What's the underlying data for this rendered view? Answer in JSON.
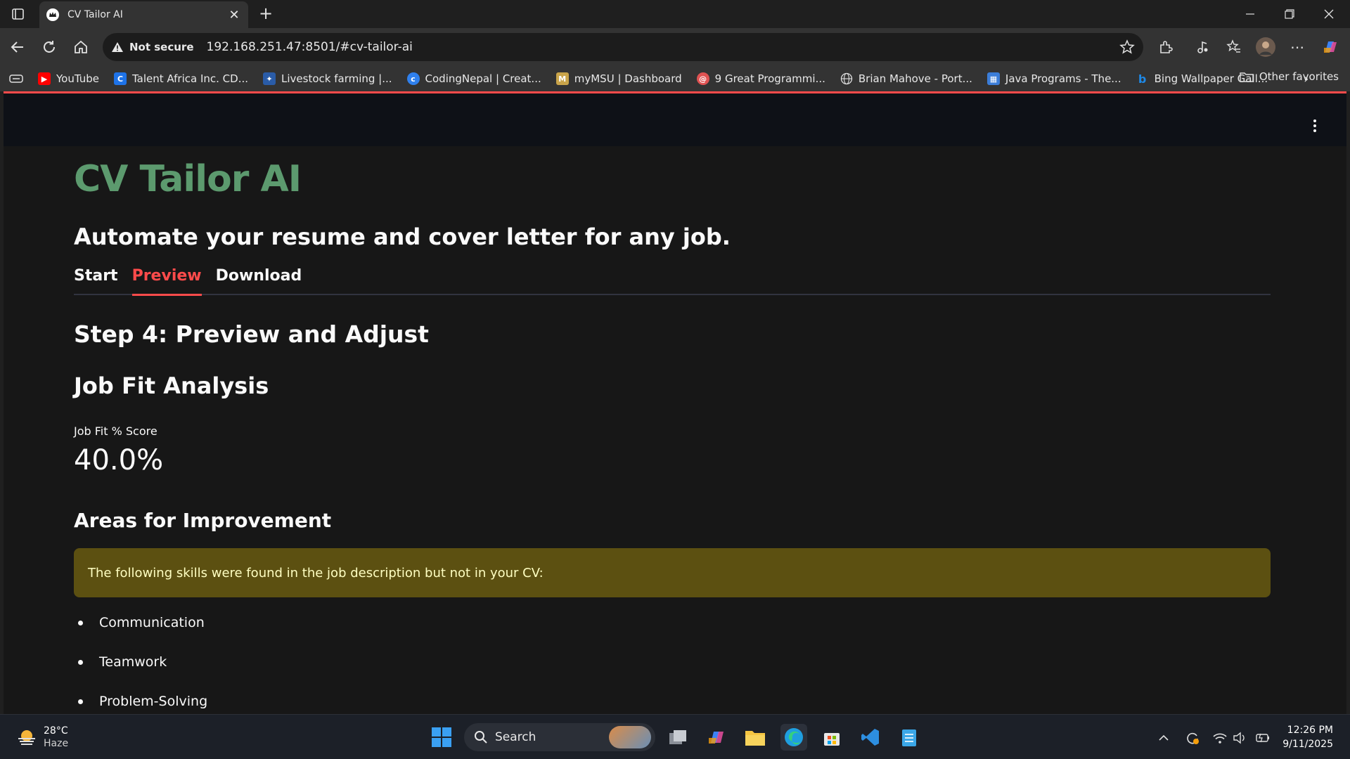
{
  "browser": {
    "tab_title": "CV Tailor AI",
    "security_label": "Not secure",
    "url": "192.168.251.47:8501/#cv-tailor-ai",
    "favorites": [
      {
        "label": "YouTube",
        "icon": "youtube-icon",
        "color": "#ff0000"
      },
      {
        "label": "Talent Africa Inc. CD...",
        "icon": "c-logo-icon",
        "color": "#1e73e8"
      },
      {
        "label": "Livestock farming |...",
        "icon": "shield-logo-icon",
        "color": "#2a5ca8"
      },
      {
        "label": "CodingNepal | Creat...",
        "icon": "codingnepal-icon",
        "color": "#2f80ed"
      },
      {
        "label": "myMSU | Dashboard",
        "icon": "msu-logo-icon",
        "color": "#c9a44a"
      },
      {
        "label": "9 Great Programmi...",
        "icon": "swirl-icon",
        "color": "#e05252"
      },
      {
        "label": "Brian Mahove - Port...",
        "icon": "globe-icon",
        "color": "#cccccc"
      },
      {
        "label": "Java Programs - The...",
        "icon": "grid-logo-icon",
        "color": "#3b7dd8"
      },
      {
        "label": "Bing Wallpaper Gall...",
        "icon": "bing-icon",
        "color": "#1e88e5"
      }
    ],
    "other_favorites": "Other favorites"
  },
  "app": {
    "title": "CV Tailor AI",
    "subtitle": "Automate your resume and cover letter for any job.",
    "tabs": [
      {
        "label": "Start",
        "active": false
      },
      {
        "label": "Preview",
        "active": true
      },
      {
        "label": "Download",
        "active": false
      }
    ],
    "step_heading": "Step 4: Preview and Adjust",
    "analysis_heading": "Job Fit Analysis",
    "metric_label": "Job Fit % Score",
    "metric_value": "40.0%",
    "improvement_heading": "Areas for Improvement",
    "warning_text": "The following skills were found in the job description but not in your CV:",
    "missing_skills": [
      "Communication",
      "Teamwork",
      "Problem-Solving"
    ],
    "accent_color": "#ff4b4b",
    "title_color": "#5c9a6e"
  },
  "taskbar": {
    "weather_temp": "28°C",
    "weather_condition": "Haze",
    "search_label": "Search",
    "time": "12:26 PM",
    "date": "9/11/2025"
  }
}
